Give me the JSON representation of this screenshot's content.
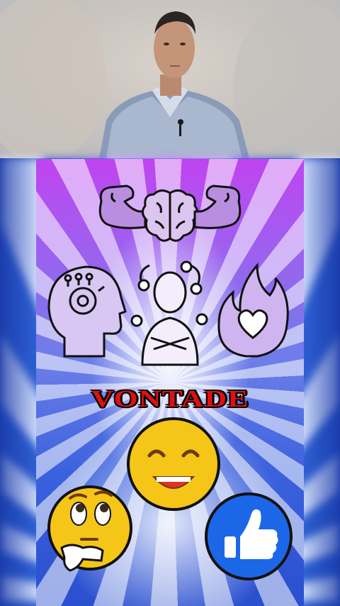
{
  "poster": {
    "word": "VONTADE"
  },
  "colors": {
    "accent_red": "#e01010",
    "emoji_yellow": "#f5c518",
    "like_blue": "#1c67e8"
  },
  "icons": [
    "strong-arm-icon",
    "brain-icon",
    "strong-arm-icon",
    "head-gears-icon",
    "self-love-person-icon",
    "heart-flame-icon",
    "smiling-emoji-icon",
    "thinking-emoji-icon",
    "thumbs-up-icon"
  ]
}
